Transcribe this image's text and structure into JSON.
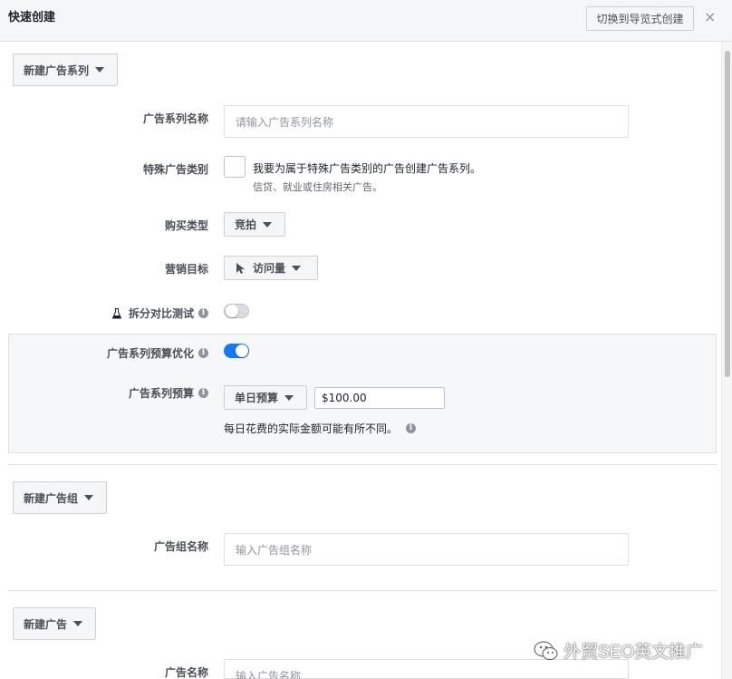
{
  "header": {
    "title": "快速创建",
    "switch_button": "切换到导览式创建",
    "close": "×"
  },
  "campaign": {
    "new_button": "新建广告系列",
    "name_label": "广告系列名称",
    "name_placeholder": "请输入广告系列名称",
    "special_label": "特殊广告类别",
    "special_checkbox_text": "我要为属于特殊广告类别的广告创建广告系列。",
    "special_checkbox_sub": "信贷、就业或住房相关广告。",
    "buying_type_label": "购买类型",
    "buying_type_value": "竞拍",
    "objective_label": "营销目标",
    "objective_value": "访问量",
    "split_test_label": "拆分对比测试",
    "split_test_on": false,
    "cbo_label": "广告系列预算优化",
    "cbo_on": true,
    "budget_label": "广告系列预算",
    "budget_type": "单日预算",
    "budget_amount": "$100.00",
    "budget_note": "每日花费的实际金额可能有所不同。"
  },
  "adset": {
    "new_button": "新建广告组",
    "name_label": "广告组名称",
    "name_placeholder": "输入广告组名称"
  },
  "ad": {
    "new_button": "新建广告",
    "name_label": "广告名称",
    "name_placeholder": "输入广告名称"
  },
  "watermark": {
    "text": "外贸SEO英文推广"
  },
  "colors": {
    "accent": "#1877f2",
    "panel_bg": "#f6f7f9",
    "border": "#dddfe2"
  }
}
